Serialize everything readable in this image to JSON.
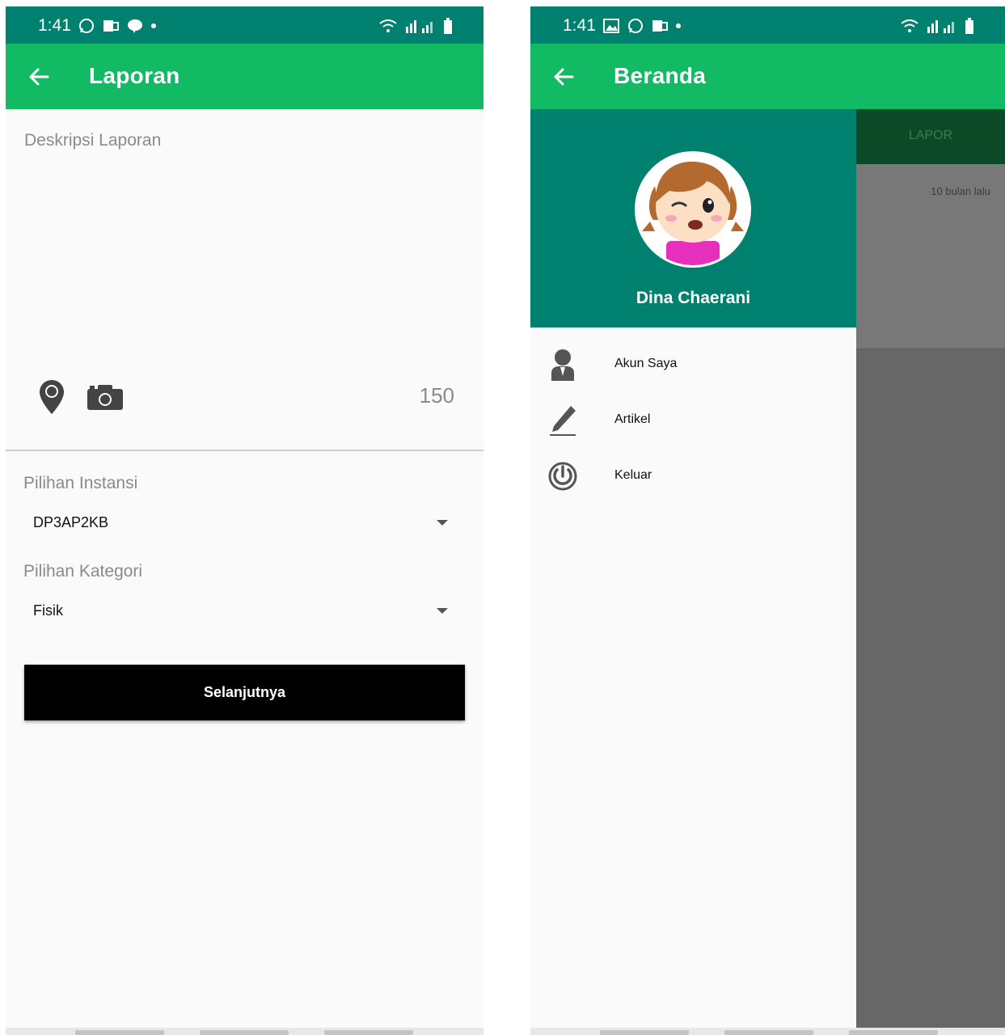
{
  "left_screen": {
    "status_time": "1:41",
    "title": "Laporan",
    "description_placeholder": "Deskripsi Laporan",
    "char_counter": "150",
    "instansi_label": "Pilihan Instansi",
    "instansi_value": "DP3AP2KB",
    "kategori_label": "Pilihan Kategori",
    "kategori_value": "Fisik",
    "next_button": "Selanjutnya"
  },
  "right_screen": {
    "status_time": "1:41",
    "title": "Beranda",
    "tab_label": "LAPOR",
    "background_time_ago": "10 bulan lalu",
    "user_name": "Dina Chaerani",
    "menu": [
      {
        "label": "Akun Saya",
        "icon": "person-icon"
      },
      {
        "label": "Artikel",
        "icon": "pen-icon"
      },
      {
        "label": "Keluar",
        "icon": "power-icon"
      }
    ]
  },
  "colors": {
    "status_bar": "#00806e",
    "app_bar": "#12bb63",
    "drawer_header": "#00806e",
    "button": "#000000",
    "scrim": "#676767"
  }
}
